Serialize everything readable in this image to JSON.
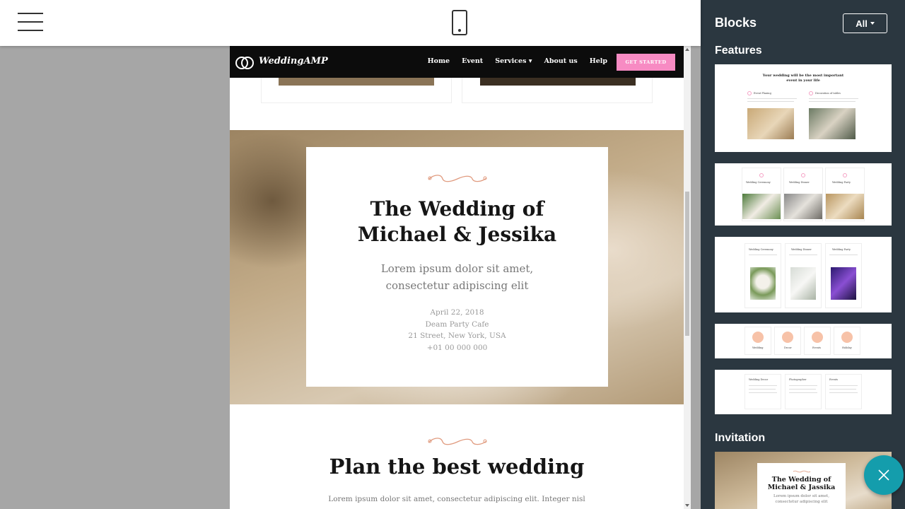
{
  "toolbar": {
    "menu_icon": "hamburger-icon",
    "device_icon": "mobile-phone-icon"
  },
  "site": {
    "brand": "WeddingAMP",
    "nav": [
      "Home",
      "Event",
      "Services ▾",
      "About us",
      "Help"
    ],
    "cta": "GET STARTED",
    "accent_color": "#f78bc3",
    "hero": {
      "title_line1": "The Wedding of",
      "title_line2": "Michael & Jessika",
      "subtitle_line1": "Lorem ipsum dolor sit amet,",
      "subtitle_line2": "consectetur adipiscing elit",
      "date": "April 22, 2018",
      "venue": "Deam Party Cafe",
      "address": "21 Street, New York, USA",
      "phone": "+01 00 000 000"
    },
    "plan": {
      "title": "Plan the best wedding",
      "text": "Lorem ipsum dolor sit amet, consectetur adipiscing elit. Integer nisl"
    }
  },
  "sidebar": {
    "title": "Blocks",
    "filter": "All",
    "sections": [
      {
        "name": "Features",
        "thumbs": [
          {
            "heading_line1": "Your wedding will be the most important",
            "heading_line2": "event in your life",
            "labels": [
              "Event Planing",
              "Decoration of tables"
            ]
          },
          {
            "labels": [
              "Wedding Ceremony",
              "Wedding Dinner",
              "Wedding Party"
            ]
          },
          {
            "labels": [
              "Wedding Ceremony",
              "Wedding Dinner",
              "Wedding Party"
            ]
          },
          {
            "labels": [
              "Wedding",
              "Decor",
              "Events",
              "Holiday"
            ]
          },
          {
            "labels": [
              "Wedding Decor",
              "Photographer",
              "Events"
            ]
          }
        ]
      },
      {
        "name": "Invitation",
        "thumbs": [
          {
            "title_line1": "The Wedding of",
            "title_line2": "Michael & Jassika",
            "sub_line1": "Lorem ipsum dolor sit amet,",
            "sub_line2": "consectetur adipiscing elit"
          }
        ]
      }
    ]
  },
  "fab_icon": "close-icon",
  "colors": {
    "sidebar_bg": "#2b3740",
    "fab": "#149dac",
    "canvas": "#a6a6a6"
  }
}
